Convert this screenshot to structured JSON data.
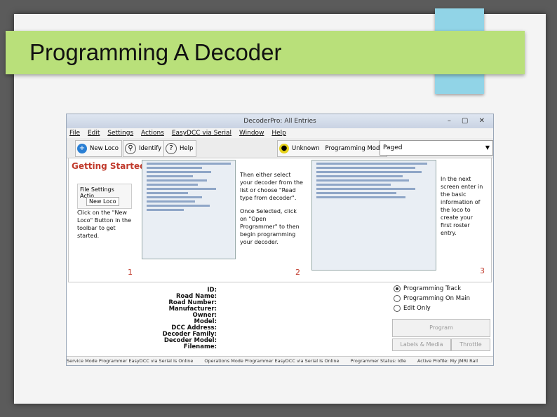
{
  "slide": {
    "title": "Programming A Decoder"
  },
  "window": {
    "title": "DecoderPro: All Entries",
    "controls": "– ▢ ✕"
  },
  "menu": [
    "File",
    "Edit",
    "Settings",
    "Actions",
    "EasyDCC via Serial",
    "Window",
    "Help"
  ],
  "toolbar": {
    "new_loco": "New Loco",
    "identify": "Identify",
    "help": "Help",
    "unknown": "Unknown",
    "mode_label": "Programming Mode",
    "mode_value": "Paged"
  },
  "getting_started": {
    "title": "Getting Started",
    "mini_menu": "File  Settings  Actio",
    "mini_button": "New Loco",
    "step1": "Click on the \"New Loco\" Button in the toolbar to get started.",
    "step2": "Then either select your decoder from the list or choose \"Read type from decoder\".",
    "step2b": "Once Selected, click on \"Open Programmer\" to then begin programming your decoder.",
    "step3": "In the next screen enter in the basic information of the loco to create your first roster entry.",
    "n1": "1",
    "n2": "2",
    "n3": "3"
  },
  "roster_fields": [
    "ID:",
    "Road Name:",
    "Road Number:",
    "Manufacturer:",
    "Owner:",
    "Model:",
    "DCC Address:",
    "Decoder Family:",
    "Decoder Model:",
    "Filename:"
  ],
  "prog_options": {
    "track": "Programming Track",
    "main": "Programming On Main",
    "edit": "Edit Only",
    "program": "Program",
    "labels": "Labels & Media",
    "throttle": "Throttle"
  },
  "status": [
    "Service Mode Programmer EasyDCC via Serial Is Online",
    "Operations Mode Programmer EasyDCC via Serial Is Online",
    "Programmer Status: Idle",
    "Active Profile: My JMRI Rail"
  ]
}
